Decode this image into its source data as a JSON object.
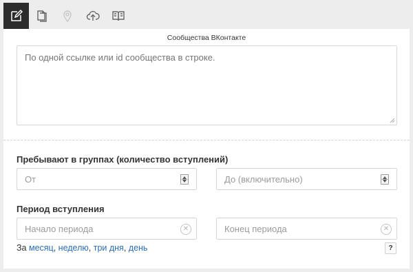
{
  "toolbar": {
    "items": [
      {
        "icon": "edit-icon",
        "active": true
      },
      {
        "icon": "copy-icon",
        "active": false
      },
      {
        "icon": "map-pin-icon",
        "active": false,
        "disabled": true
      },
      {
        "icon": "cloud-upload-icon",
        "active": false
      },
      {
        "icon": "book-icon",
        "active": false
      }
    ]
  },
  "communities": {
    "title": "Сообщества ВКонтакте",
    "placeholder": "По одной ссылке или id сообщества в строке."
  },
  "groups": {
    "label": "Пребывают в группах (количество вступлений)",
    "from_placeholder": "От",
    "to_placeholder": "До (включительно)"
  },
  "period": {
    "label": "Период вступления",
    "start_placeholder": "Начало периода",
    "end_placeholder": "Конец периода",
    "clear_symbol": "✕"
  },
  "quick": {
    "prefix": "За ",
    "month": "месяц",
    "sep1": ", ",
    "week": "неделю",
    "sep2": ", ",
    "three_days": "три дня",
    "sep3": ", ",
    "day": "день"
  },
  "help": {
    "label": "?"
  },
  "colors": {
    "active_tab_bg": "#2c2c2c",
    "link": "#2a6db6",
    "page_bg": "#ededed"
  }
}
